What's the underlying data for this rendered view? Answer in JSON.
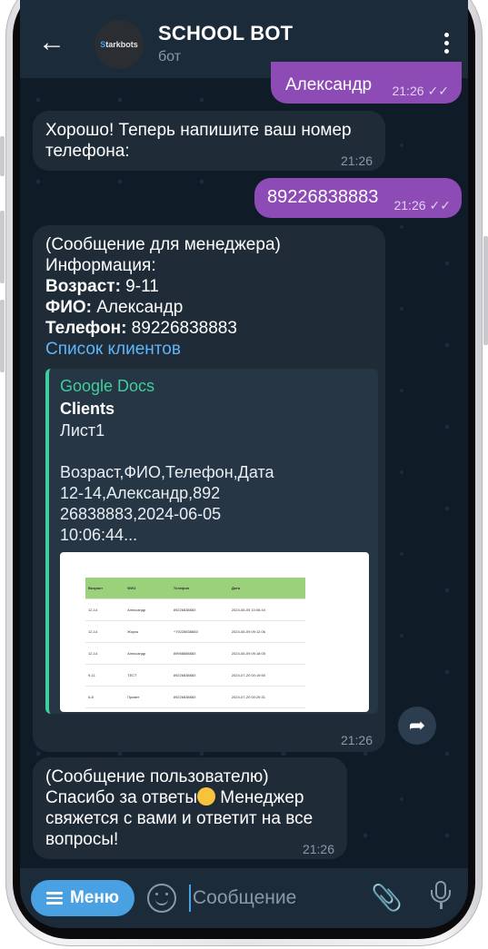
{
  "header": {
    "back_icon": "arrow-left-icon",
    "avatar_text_prefix": "S",
    "avatar_text_rest": "tarkbots",
    "title": "SCHOOL BOT",
    "subtitle": "бот",
    "menu_icon": "more-vertical-icon"
  },
  "messages": {
    "out_name": {
      "text": "Александр",
      "time": "21:26",
      "status": "read"
    },
    "in_phone_prompt": {
      "text": "Хорошо! Теперь напишите ваш номер телефона:",
      "time": "21:26"
    },
    "out_phone": {
      "text": "89226838883",
      "time": "21:26",
      "status": "read"
    },
    "manager": {
      "line1": "(Сообщение для менеджера)",
      "line2": "Информация:",
      "age_label": "Возраст:",
      "age_value": " 9-11",
      "fio_label": "ФИО:",
      "fio_value": " Александр",
      "phone_label": "Телефон:",
      "phone_value": " 89226838883",
      "link": "Список клиентов",
      "preview": {
        "site": "Google Docs",
        "title": "Clients",
        "description": "Лист1\n\nВозраст,ФИО,Телефон,Дата\n12-14,Александр,892\n26838883,2024-06-05\n10:06:44..."
      },
      "time": "21:26"
    },
    "user_reply": {
      "line1": "(Сообщение пользователю)",
      "line2": "Спасибо за ответы",
      "line3": " Менеджер свяжется с вами и ответит на все вопросы!",
      "time": "21:26"
    }
  },
  "sheet": {
    "headers": [
      "Возраст",
      "ФИО",
      "Телефон",
      "Дата"
    ],
    "rows": [
      [
        "12-14",
        "Александр",
        "89226838883",
        "2024-06-05 10:06:44"
      ],
      [
        "12-14",
        "Жорик",
        "+79228838883",
        "2024-06-09 09:12:06"
      ],
      [
        "12-14",
        "Александр",
        "89988888883",
        "2024-06-09 09:18:05"
      ],
      [
        "9-11",
        "ТЕСТ",
        "89226838883",
        "2024-07-20 00:19:50"
      ],
      [
        "6-8",
        "Привет",
        "89226838883",
        "2024-07-20 00:29:31"
      ]
    ]
  },
  "input": {
    "menu_label": "Меню",
    "placeholder": "Сообщение",
    "emoji_icon": "smile-icon",
    "attach_icon": "paperclip-icon",
    "mic_icon": "microphone-icon",
    "share_icon": "share-arrow-icon"
  }
}
